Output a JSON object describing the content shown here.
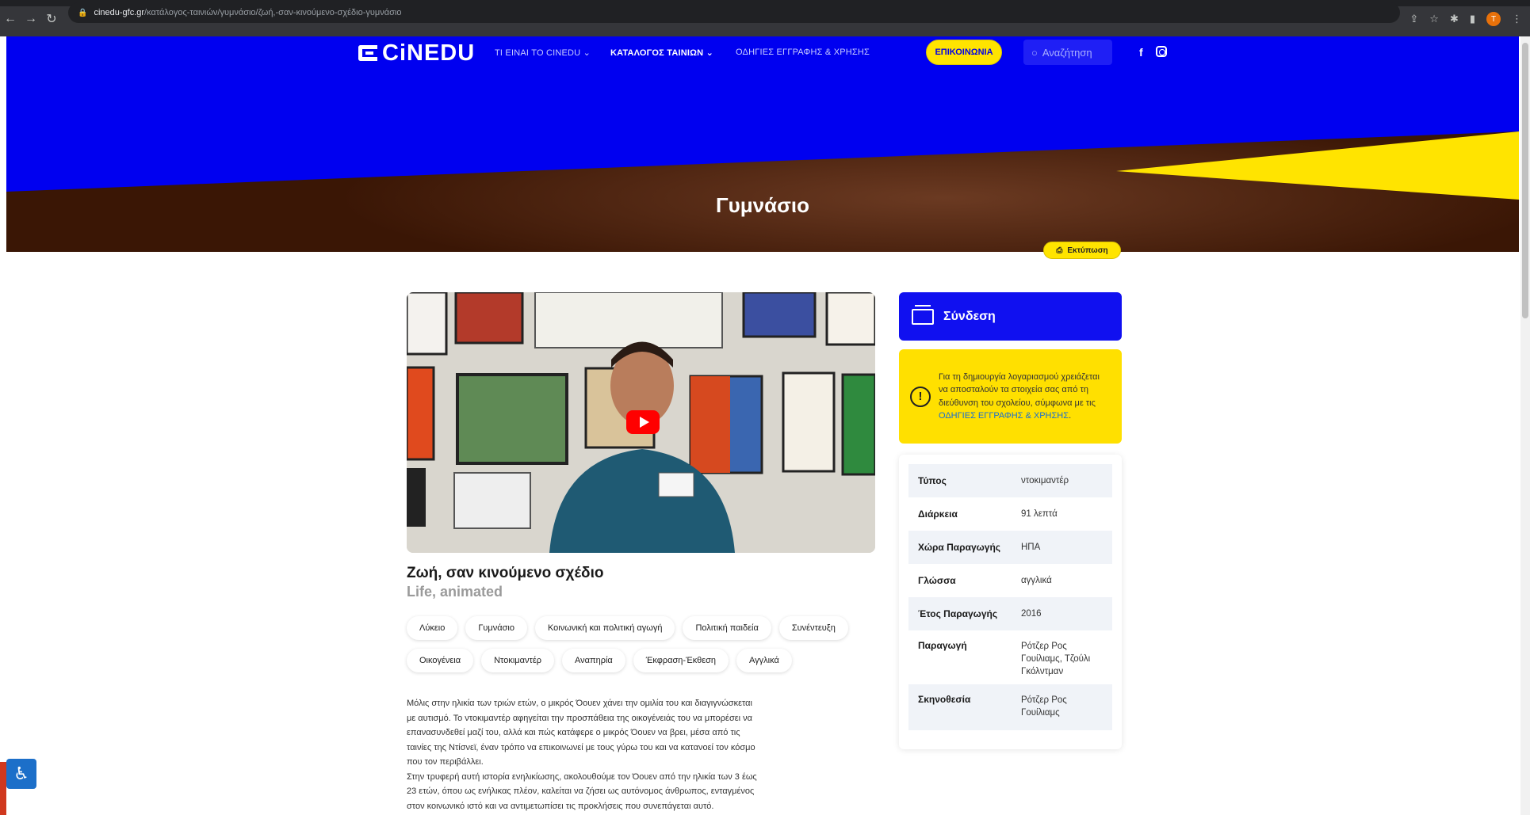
{
  "browser": {
    "url_host": "cinedu-gfc.gr",
    "url_path": "/κατάλογος-ταινιών/γυμνάσιο/ζωή,-σαν-κινούμενο-σχέδιο-γυμνάσιο",
    "profile_initial": "T"
  },
  "nav": {
    "logo": "CiNEDU",
    "items": [
      {
        "label": "ΤΙ ΕΙΝΑΙ ΤΟ CINEDU ⌄"
      },
      {
        "label": "ΚΑΤΑΛΟΓΟΣ ΤΑΙΝΙΩΝ ⌄"
      },
      {
        "label": "ΟΔΗΓΙΕΣ ΕΓΓΡΑΦΗΣ & ΧΡΗΣΗΣ"
      }
    ],
    "contact": "ΕΠΙΚΟΙΝΩΝΙΑ",
    "search_placeholder": "Αναζήτηση",
    "facebook": "f"
  },
  "hero": {
    "title": "Γυμνάσιο"
  },
  "print_label": "Εκτύπωση",
  "film": {
    "title": "Ζωή, σαν κινούμενο σχέδιο",
    "subtitle": "Life, animated",
    "tags": [
      "Λύκειο",
      "Γυμνάσιο",
      "Κοινωνική και πολιτική αγωγή",
      "Πολιτική παιδεία",
      "Συνέντευξη",
      "Οικογένεια",
      "Ντοκιμαντέρ",
      "Αναπηρία",
      "Έκφραση-Έκθεση",
      "Αγγλικά"
    ],
    "description_lines": [
      "Μόλις στην ηλικία των τριών ετών, ο μικρός Όουεν χάνει την ομιλία του και διαγιγνώσκεται",
      "με αυτισμό. Το ντοκιμαντέρ αφηγείται την προσπάθεια της οικογένειάς του να μπορέσει να",
      "επανασυνδεθεί μαζί του, αλλά και πώς κατάφερε ο μικρός Όουεν να βρει, μέσα από τις",
      "ταινίες της Ντίσνεϊ, έναν τρόπο να επικοινωνεί με τους γύρω του και να κατανοεί τον κόσμο",
      "που τον περιβάλλει.",
      "Στην τρυφερή αυτή ιστορία ενηλικίωσης, ακολουθούμε τον Όουεν από την ηλικία των 3 έως",
      "23 ετών, όπου ως ενήλικας πλέον, καλείται να ζήσει ως αυτόνομος άνθρωπος, ενταγμένος",
      "στον κοινωνικό ιστό και να αντιμετωπίσει τις προκλήσεις που συνεπάγεται αυτό."
    ]
  },
  "login": {
    "label": "Σύνδεση"
  },
  "notice": {
    "text": "Για τη δημιουργία λογαριασμού χρειάζεται να αποσταλούν τα στοιχεία σας από τη διεύθυνση του σχολείου, σύμφωνα με τις",
    "link": "ΟΔΗΓΙΕΣ ΕΓΓΡΑΦΗΣ & ΧΡΗΣΗΣ",
    "tail": "."
  },
  "info": [
    {
      "label": "Τύπος",
      "value": "ντοκιμαντέρ"
    },
    {
      "label": "Διάρκεια",
      "value": "91 λεπτά"
    },
    {
      "label": "Χώρα Παραγωγής",
      "value": "ΗΠΑ"
    },
    {
      "label": "Γλώσσα",
      "value": "αγγλικά"
    },
    {
      "label": "Έτος Παραγωγής",
      "value": "2016"
    },
    {
      "label": "Παραγωγή",
      "value": "Ρότζερ Ρος Γουίλιαμς, Τζούλι Γκόλντμαν"
    },
    {
      "label": "Σκηνοθεσία",
      "value": "Ρότζερ Ρος Γουίλιαμς"
    }
  ],
  "colors": {
    "brand_blue": "#0000f0",
    "brand_yellow": "#ffe400",
    "hero_brown": "#3a1605"
  }
}
